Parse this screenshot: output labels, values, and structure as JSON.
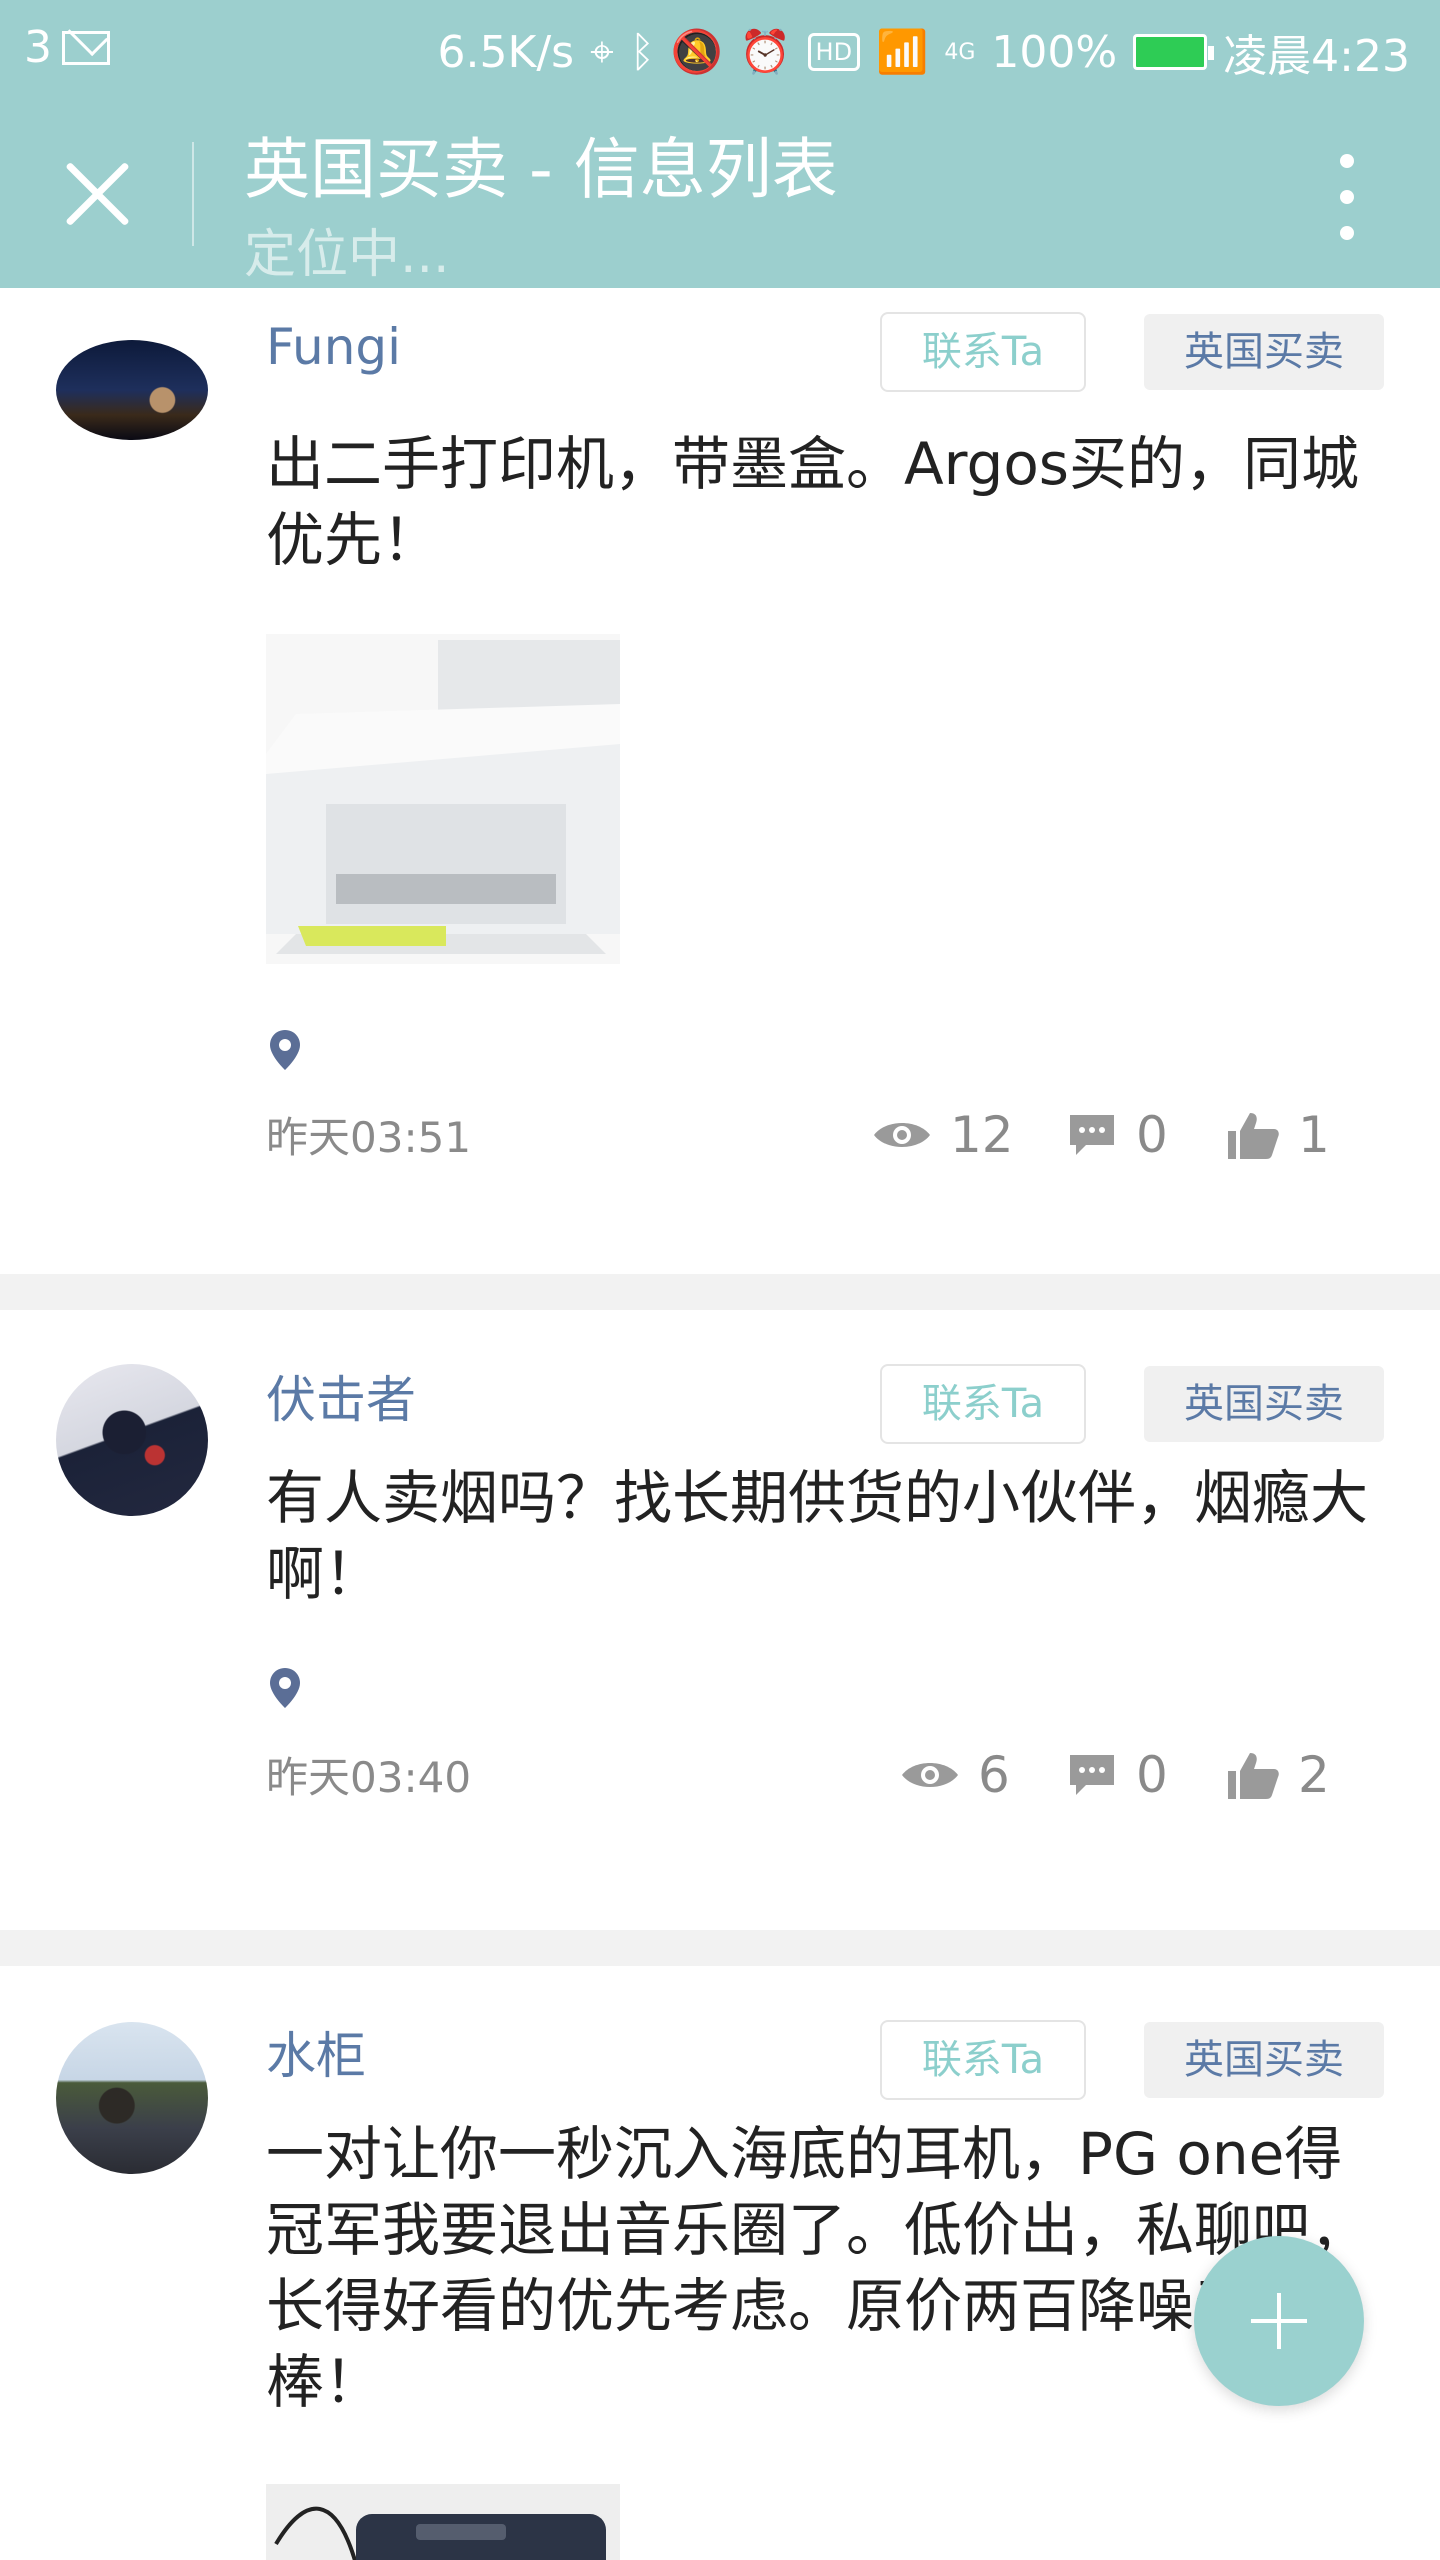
{
  "status_bar": {
    "notification_count": "3",
    "net_speed": "6.5K/s",
    "network_type": "4G",
    "hd": "HD",
    "battery": "100%",
    "time": "凌晨4:23"
  },
  "header": {
    "title": "英国买卖 - 信息列表",
    "subtitle": "定位中..."
  },
  "posts": [
    {
      "username": "Fungi",
      "contact_label": "联系Ta",
      "category": "英国买卖",
      "content": "出二手打印机，带墨盒。Argos买的，同城优先！",
      "time": "昨天03:51",
      "views": "12",
      "comments": "0",
      "likes": "1"
    },
    {
      "username": "伏击者",
      "contact_label": "联系Ta",
      "category": "英国买卖",
      "content": "有人卖烟吗？找长期供货的小伙伴，烟瘾大啊！",
      "time": "昨天03:40",
      "views": "6",
      "comments": "0",
      "likes": "2"
    },
    {
      "username": "水柜",
      "contact_label": "联系Ta",
      "category": "英国买卖",
      "content": "一对让你一秒沉入海底的耳机，PG one得冠军我要退出音乐圈了。低价出，私聊吧，长得好看的优先考虑。原价两百降噪无敌棒！"
    }
  ],
  "colors": {
    "header_bg": "#9ccfce",
    "username": "#5b7aa6",
    "contact_text": "#8ccfcc",
    "meta_text": "#8a8a8a",
    "fab": "#9ad1cf"
  },
  "icons": [
    "close-icon",
    "more-vertical-icon",
    "location-pin-icon",
    "eye-icon",
    "comment-icon",
    "thumbs-up-icon",
    "plus-icon"
  ]
}
